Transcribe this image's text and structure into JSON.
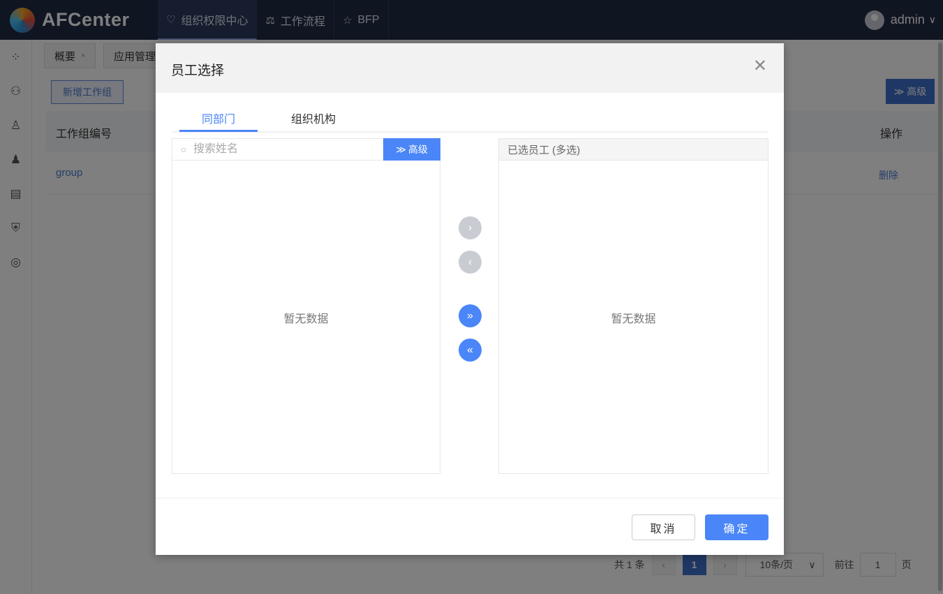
{
  "app": {
    "logo_text": "AFCenter"
  },
  "nav": [
    {
      "label": "组织权限中心",
      "icon": "heart-shield-icon",
      "active": true
    },
    {
      "label": "工作流程",
      "icon": "scale-icon",
      "active": false
    },
    {
      "label": "BFP",
      "icon": "star-icon",
      "active": false
    }
  ],
  "user": {
    "name": "admin"
  },
  "sidebar_icons": [
    "apps-icon",
    "users-icon",
    "user-icon",
    "user-profile-icon",
    "report-icon",
    "shield-plus-icon",
    "settings-icon"
  ],
  "page_tabs": [
    {
      "label": "概要",
      "close": "×"
    },
    {
      "label": "应用管理"
    }
  ],
  "background": {
    "add_button": "新增工作组",
    "advanced_button": "≫ 高级",
    "table": {
      "col_first": "工作组编号",
      "col_action": "操作",
      "rows": [
        {
          "code": "group",
          "action": "删除"
        }
      ]
    },
    "pager": {
      "total": "共 1 条",
      "page": "1",
      "page_size": "10条/页",
      "goto_prefix": "前往",
      "goto_value": "1",
      "goto_suffix": "页"
    }
  },
  "dialog": {
    "title": "员工选择",
    "tabs": [
      "同部门",
      "组织机构"
    ],
    "search": {
      "placeholder": "搜索姓名",
      "advanced_label": "高级"
    },
    "left_empty": "暂无数据",
    "right_header": "已选员工 (多选)",
    "right_empty": "暂无数据",
    "transfer_buttons": [
      {
        "glyph": "›",
        "enabled": false
      },
      {
        "glyph": "‹",
        "enabled": false
      },
      {
        "glyph": "»",
        "enabled": true
      },
      {
        "glyph": "«",
        "enabled": true
      }
    ],
    "cancel_label": "取消",
    "confirm_label": "确定"
  },
  "colors": {
    "primary": "#4a86f7",
    "topbar": "#202a44"
  }
}
